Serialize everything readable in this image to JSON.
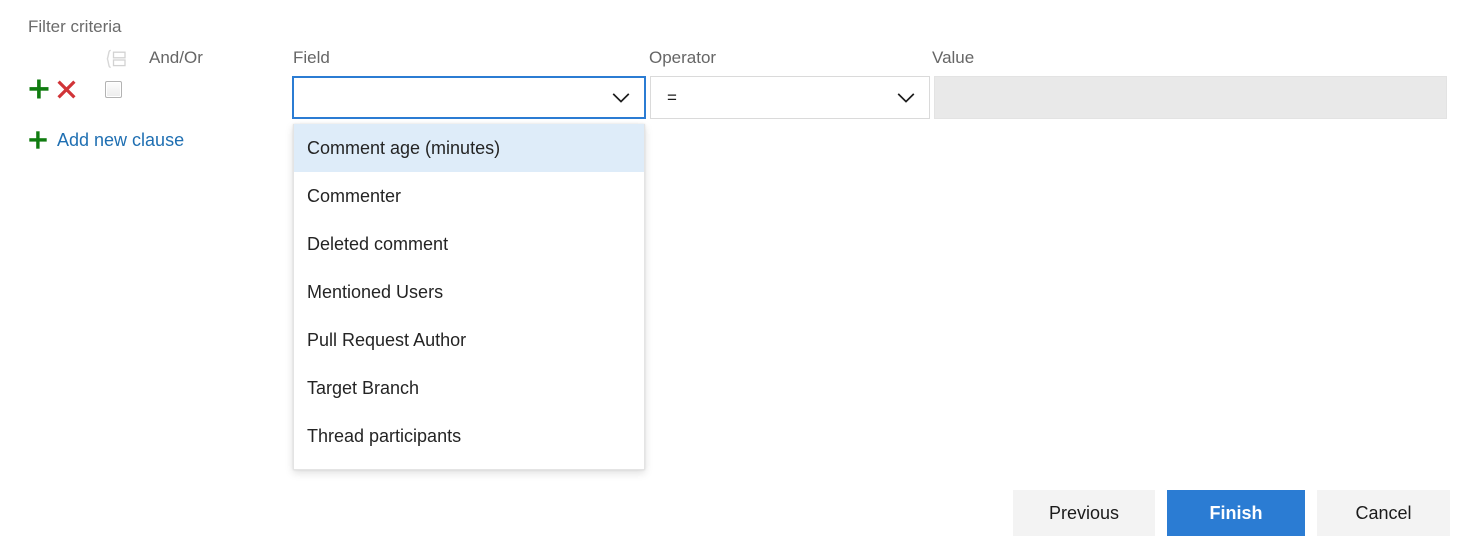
{
  "section": {
    "title": "Filter criteria"
  },
  "columns": {
    "andor": "And/Or",
    "field": "Field",
    "operator": "Operator",
    "value": "Value"
  },
  "clause_row": {
    "add_icon": "plus-icon",
    "remove_icon": "close-x-icon",
    "group_icon": "group-clause-icon",
    "group_checkbox_checked": false
  },
  "add_clause": {
    "icon": "plus-icon",
    "label": "Add new clause"
  },
  "inputs": {
    "field": {
      "value": "",
      "placeholder": "",
      "focused": true,
      "chevron_icon": "chevron-down-icon"
    },
    "operator": {
      "value": "=",
      "chevron_icon": "chevron-down-icon"
    },
    "value": {
      "value": "",
      "disabled": true
    }
  },
  "dropdown": {
    "open": true,
    "selected_index": 0,
    "items": [
      {
        "label": "Comment age (minutes)"
      },
      {
        "label": "Commenter"
      },
      {
        "label": "Deleted comment"
      },
      {
        "label": "Mentioned Users"
      },
      {
        "label": "Pull Request Author"
      },
      {
        "label": "Target Branch"
      },
      {
        "label": "Thread participants"
      }
    ]
  },
  "footer": {
    "previous_label": "Previous",
    "finish_label": "Finish",
    "cancel_label": "Cancel"
  },
  "colors": {
    "accent": "#2b7cd3",
    "link": "#1f6fb2",
    "add_green": "#107c10",
    "remove_red": "#d13438",
    "highlight": "#deecf9",
    "disabled_bg": "#e9e9e9"
  }
}
